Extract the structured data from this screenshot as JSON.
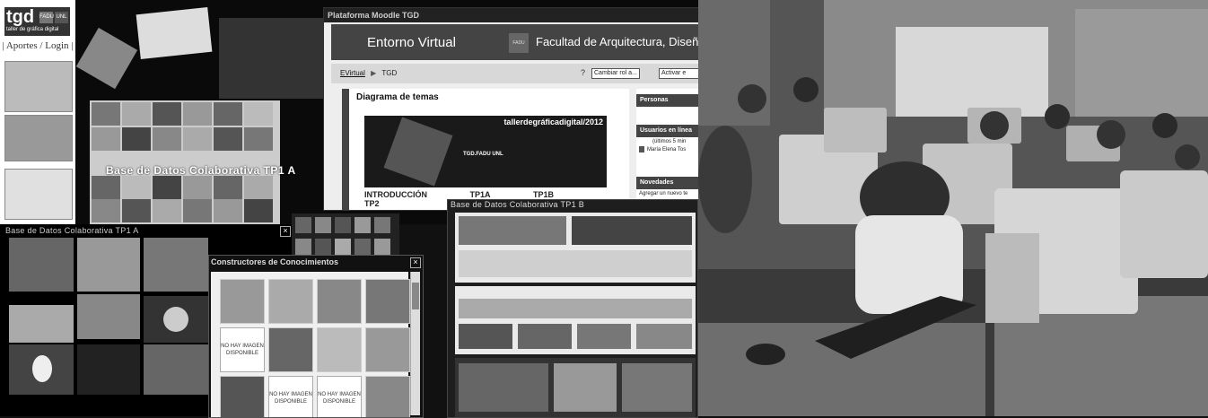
{
  "left_panel": {
    "logo_text": "tgd",
    "logo_badge_1": "FADU",
    "logo_badge_2": "UNL",
    "logo_subtitle": "taller de gráfica digital",
    "nav_text": "| Aportes / Login |"
  },
  "moodle": {
    "window_title": "Plataforma Moodle TGD",
    "site_title": "Entorno Virtual",
    "fadu_badge": "FADU",
    "faculty_name": "Facultad de Arquitectura, Diseño y",
    "breadcrumb_home": "EVirtual",
    "breadcrumb_sep": "▶",
    "breadcrumb_current": "TGD",
    "role_select": "Cambiar rol a...",
    "activate_button": "Activar e",
    "section_heading": "Diagrama de temas",
    "banner_text": "tallerdegráficadigital/2012",
    "banner_code": "TGD.FADU UNL",
    "tabs": [
      "INTRODUCCIÓN",
      "TP1A",
      "TP1B",
      "TP2"
    ],
    "side_blocks": [
      {
        "title": "Personas",
        "lines": []
      },
      {
        "title": "Usuarios en línea",
        "lines": [
          "(últimos 5 min",
          "María Elena Tos"
        ]
      },
      {
        "title": "Novedades",
        "lines": [
          "Agregar un nuevo te"
        ]
      }
    ]
  },
  "collage_caption": "Base de Datos Colaborativa TP1 A",
  "tp1a_window": {
    "title": "Base de Datos Colaborativa TP1 A",
    "close": "×"
  },
  "tp1b_window": {
    "title": "Base de Datos Colaborativa TP1 B"
  },
  "constructores_window": {
    "title": "Constructores de Conocimientos",
    "close": "×",
    "no_image_text": "NO HAY IMAGEN DISPONIBLE"
  },
  "colors": {
    "background": "#111111",
    "moodle_header": "#444444",
    "panel_white": "#ffffff"
  }
}
